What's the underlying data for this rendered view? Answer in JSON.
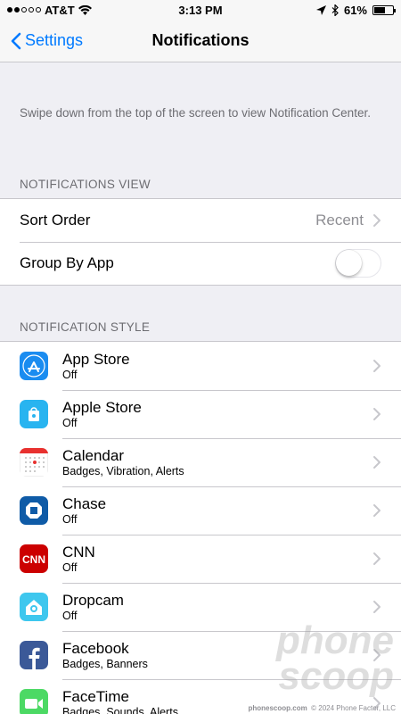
{
  "status_bar": {
    "carrier": "AT&T",
    "time": "3:13 PM",
    "battery": "61%",
    "battery_level": 0.61
  },
  "nav": {
    "back_label": "Settings",
    "title": "Notifications"
  },
  "description": "Swipe down from the top of the screen to view Notification Center.",
  "notifications_view": {
    "header": "NOTIFICATIONS VIEW",
    "sort_order_label": "Sort Order",
    "sort_order_value": "Recent",
    "group_by_app_label": "Group By App",
    "group_by_app_on": false
  },
  "notification_style": {
    "header": "NOTIFICATION STYLE",
    "apps": [
      {
        "name": "App Store",
        "status": "Off",
        "icon": "app-store-icon",
        "color": "#1a8cf0"
      },
      {
        "name": "Apple Store",
        "status": "Off",
        "icon": "apple-store-icon",
        "color": "#28b4f0"
      },
      {
        "name": "Calendar",
        "status": "Badges, Vibration, Alerts",
        "icon": "calendar-icon",
        "color": "#ffffff"
      },
      {
        "name": "Chase",
        "status": "Off",
        "icon": "chase-icon",
        "color": "#0f5ba7"
      },
      {
        "name": "CNN",
        "status": "Off",
        "icon": "cnn-icon",
        "color": "#cc0000"
      },
      {
        "name": "Dropcam",
        "status": "Off",
        "icon": "dropcam-icon",
        "color": "#3ec7ee"
      },
      {
        "name": "Facebook",
        "status": "Badges, Banners",
        "icon": "facebook-icon",
        "color": "#3b5998"
      },
      {
        "name": "FaceTime",
        "status": "Badges, Sounds, Alerts",
        "icon": "facetime-icon",
        "color": "#4cd964"
      }
    ]
  },
  "watermark": {
    "line1": "phone",
    "line2": "scoop",
    "credit_site": "phonescoop.com",
    "credit_copy": "© 2024 Phone Factor, LLC"
  }
}
